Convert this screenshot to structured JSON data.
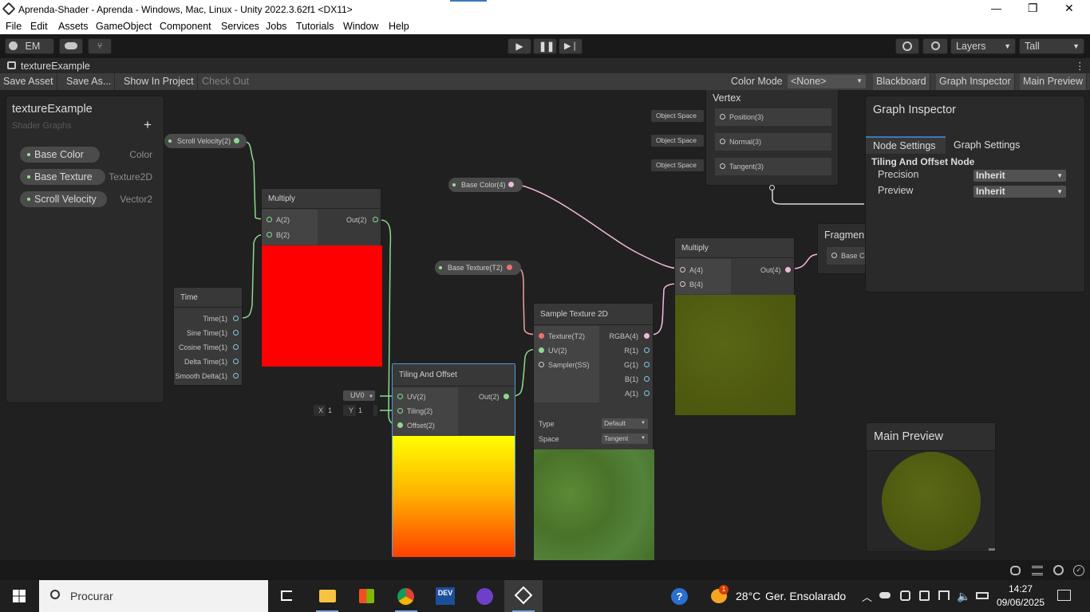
{
  "window": {
    "title": "Aprenda-Shader - Aprenda - Windows, Mac, Linux - Unity 2022.3.62f1 <DX11>",
    "minimize": "—",
    "maximize": "❐",
    "close": "✕"
  },
  "menu": [
    "File",
    "Edit",
    "Assets",
    "GameObject",
    "Component",
    "Services",
    "Jobs",
    "Tutorials",
    "Window",
    "Help"
  ],
  "toolbar": {
    "account": "EM",
    "layers": "Layers",
    "layout": "Tall"
  },
  "tab": {
    "label": "textureExample",
    "more": "⋮"
  },
  "graph_toolbar": {
    "save_asset": "Save Asset",
    "save_as": "Save As...",
    "show_in_project": "Show In Project",
    "check_out": "Check Out",
    "color_mode_label": "Color Mode",
    "color_mode_value": "<None>",
    "blackboard": "Blackboard",
    "graph_inspector": "Graph Inspector",
    "main_preview": "Main Preview"
  },
  "blackboard": {
    "title": "textureExample",
    "subtitle": "Shader Graphs",
    "add": "+",
    "properties": [
      {
        "name": "Base Color",
        "type": "Color"
      },
      {
        "name": "Base Texture",
        "type": "Texture2D"
      },
      {
        "name": "Scroll Velocity",
        "type": "Vector2"
      }
    ]
  },
  "nodes": {
    "scroll_velocity": "Scroll Velocity(2)",
    "multiply1": {
      "title": "Multiply",
      "a": "A(2)",
      "b": "B(2)",
      "out": "Out(2)"
    },
    "time": {
      "title": "Time",
      "outputs": [
        "Time(1)",
        "Sine Time(1)",
        "Cosine Time(1)",
        "Delta Time(1)",
        "Smooth Delta(1)"
      ]
    },
    "tiling": {
      "title": "Tiling And Offset",
      "uv": "UV(2)",
      "tiling": "Tiling(2)",
      "offset": "Offset(2)",
      "out": "Out(2)",
      "uv_default": "UV0",
      "x_label": "X",
      "x_value": "1",
      "y_label": "Y",
      "y_value": "1"
    },
    "base_color": "Base Color(4)",
    "base_texture": "Base Texture(T2)",
    "sample": {
      "title": "Sample Texture 2D",
      "texture": "Texture(T2)",
      "uv": "UV(2)",
      "sampler": "Sampler(SS)",
      "outputs": [
        "RGBA(4)",
        "R(1)",
        "G(1)",
        "B(1)",
        "A(1)"
      ],
      "type_label": "Type",
      "type_value": "Default",
      "space_label": "Space",
      "space_value": "Tangent"
    },
    "multiply2": {
      "title": "Multiply",
      "a": "A(4)",
      "b": "B(4)",
      "out": "Out(4)"
    },
    "vertex": {
      "title": "Vertex",
      "rows": [
        {
          "space": "Object Space",
          "port": "Position(3)"
        },
        {
          "space": "Object Space",
          "port": "Normal(3)"
        },
        {
          "space": "Object Space",
          "port": "Tangent(3)"
        }
      ]
    },
    "fragment": {
      "title": "Fragmen",
      "port": "Base Co"
    }
  },
  "inspector": {
    "title": "Graph Inspector",
    "tabs": [
      "Node Settings",
      "Graph Settings"
    ],
    "node_title": "Tiling And Offset Node",
    "rows": [
      {
        "label": "Precision",
        "value": "Inherit"
      },
      {
        "label": "Preview",
        "value": "Inherit"
      }
    ]
  },
  "main_preview": {
    "title": "Main Preview"
  },
  "taskbar": {
    "search_placeholder": "Procurar",
    "weather_temp": "28°C",
    "weather_text": "Ger. Ensolarado",
    "weather_badge": "1",
    "time": "14:27",
    "date": "09/06/2025",
    "dev_label": "DEV"
  },
  "colors": {
    "accent": "#3a79bb",
    "red_preview": "#ff0000",
    "texture_green": "#4f7a2e",
    "olive": "#4f5a10"
  }
}
